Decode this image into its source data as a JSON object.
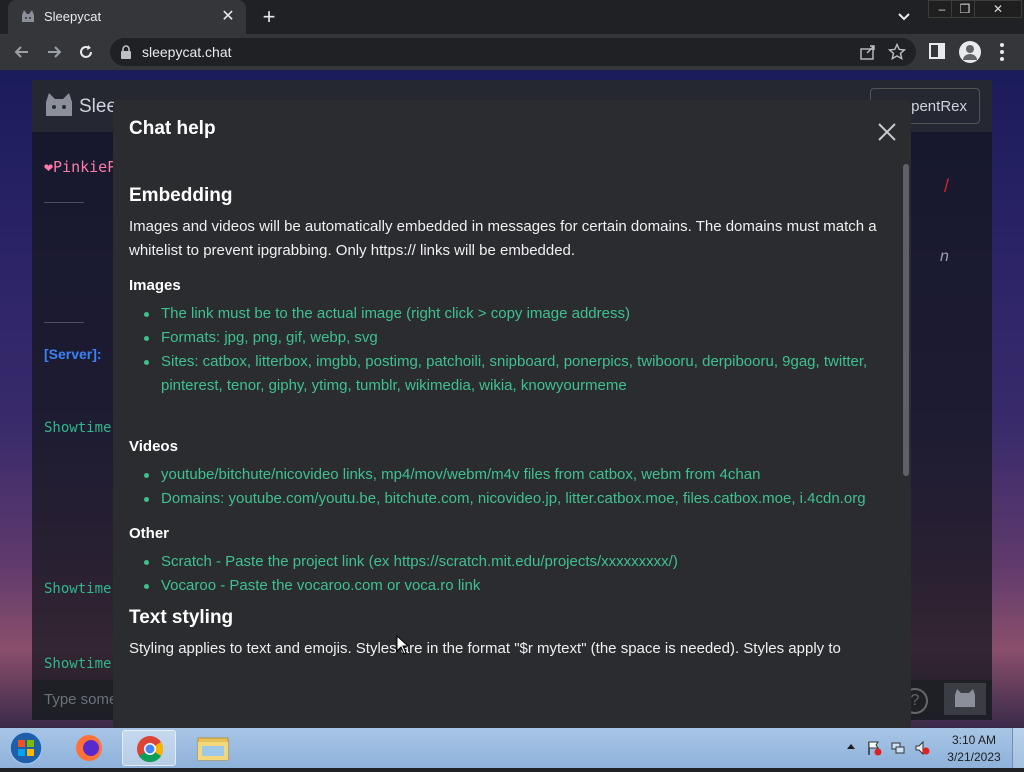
{
  "browser": {
    "tab_title": "Sleepycat",
    "url": "sleepycat.chat",
    "window_controls": [
      "–",
      "❒",
      "✕"
    ]
  },
  "app": {
    "title": "Slee",
    "user_button": "pentRex",
    "bg_pinkie": "❤PinkiePi",
    "bg_server": "[Server]:",
    "bg_showtime": "Showtime:",
    "bg_italic": "n",
    "bg_red": "/",
    "input_placeholder": "Type something",
    "help_glyph": "?"
  },
  "modal": {
    "title": "Chat help",
    "embedding": {
      "heading": "Embedding",
      "desc": "Images and videos will be automatically embedded in messages for certain domains. The domains must match a whitelist to prevent ipgrabbing. Only https:// links will be embedded.",
      "images": {
        "heading": "Images",
        "items": [
          "The link must be to the actual image (right click > copy image address)",
          "Formats: jpg, png, gif, webp, svg",
          "Sites: catbox, litterbox, imgbb, postimg, patchoili, snipboard, ponerpics, twibooru, derpibooru, 9gag, twitter, pinterest, tenor, giphy, ytimg, tumblr, wikimedia, wikia, knowyourmeme"
        ]
      },
      "videos": {
        "heading": "Videos",
        "items": [
          "youtube/bitchute/nicovideo links, mp4/mov/webm/m4v files from catbox, webm from 4chan",
          "Domains: youtube.com/youtu.be, bitchute.com, nicovideo.jp, litter.catbox.moe, files.catbox.moe, i.4cdn.org"
        ]
      },
      "other": {
        "heading": "Other",
        "items": [
          "Scratch - Paste the project link (ex https://scratch.mit.edu/projects/xxxxxxxxx/)",
          "Vocaroo - Paste the vocaroo.com or voca.ro link"
        ]
      }
    },
    "text_styling": {
      "heading": "Text styling",
      "desc": "Styling applies to text and emojis. Styles are in the format \"$r mytext\" (the space is needed). Styles apply to"
    }
  },
  "taskbar": {
    "time": "3:10 AM",
    "date": "3/21/2023"
  }
}
